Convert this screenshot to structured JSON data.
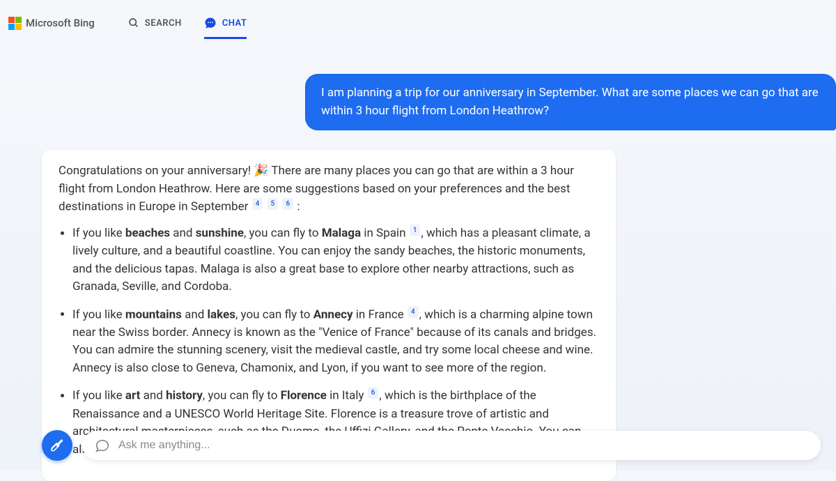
{
  "header": {
    "logo_text": "Microsoft Bing",
    "nav": {
      "search": "SEARCH",
      "chat": "CHAT"
    }
  },
  "conversation": {
    "user_message": "I am planning a trip for our anniversary in September. What are some places we can go that are within 3 hour flight from London Heathrow?",
    "bot_intro_1": "Congratulations on your anniversary! 🎉 There are many places you can go that are within a 3 hour flight from London Heathrow. Here are some suggestions based on your preferences and the best destinations in Europe in September",
    "bot_intro_citations": [
      "4",
      "5",
      "6"
    ],
    "suggestions": [
      {
        "prefix": "If you like ",
        "bold1": "beaches",
        "mid1": " and ",
        "bold2": "sunshine",
        "mid2": ", you can fly to ",
        "bold3": "Malaga",
        "mid3": " in Spain",
        "citations": [
          "1"
        ],
        "tail": ", which has a pleasant climate, a lively culture, and a beautiful coastline. You can enjoy the sandy beaches, the historic monuments, and the delicious tapas. Malaga is also a great base to explore other nearby attractions, such as Granada, Seville, and Cordoba."
      },
      {
        "prefix": "If you like ",
        "bold1": "mountains",
        "mid1": " and ",
        "bold2": "lakes",
        "mid2": ", you can fly to ",
        "bold3": "Annecy",
        "mid3": " in France",
        "citations": [
          "4"
        ],
        "tail": ", which is a charming alpine town near the Swiss border. Annecy is known as the \"Venice of France\" because of its canals and bridges. You can admire the stunning scenery, visit the medieval castle, and try some local cheese and wine. Annecy is also close to Geneva, Chamonix, and Lyon, if you want to see more of the region."
      },
      {
        "prefix": "If you like ",
        "bold1": "art",
        "mid1": " and ",
        "bold2": "history",
        "mid2": ", you can fly to ",
        "bold3": "Florence",
        "mid3": " in Italy",
        "citations": [
          "6"
        ],
        "tail": ", which is the birthplace of the Renaissance and a UNESCO World Heritage Site. Florence is a treasure trove of artistic and architectural masterpieces, such as the Duomo, the Uffizi Gallery, and the Ponte Vecchio. You can also explore the Tuscan countryside, taste the famous gelato, and shop for leather goods."
      }
    ]
  },
  "input": {
    "placeholder": "Ask me anything..."
  }
}
